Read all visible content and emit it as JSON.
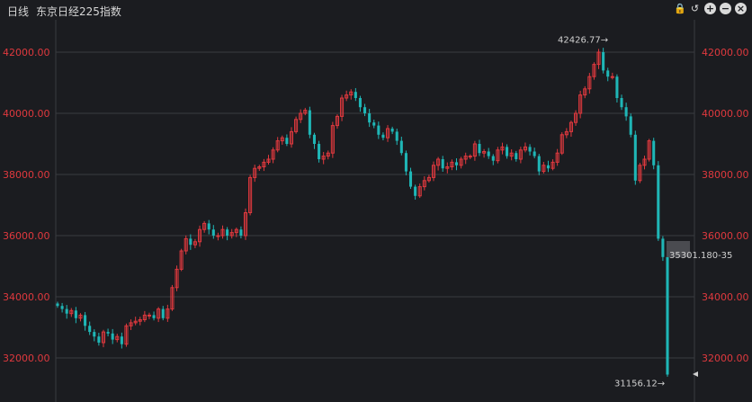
{
  "toolbar": {
    "period": "日线",
    "index_name": "东京日经225指数",
    "icons": [
      "lock-icon",
      "undo-icon",
      "zoom-in-icon",
      "zoom-out-icon",
      "close-icon"
    ]
  },
  "colors": {
    "background": "#1b1c20",
    "grid": "#3a3b40",
    "up": "#e0393e",
    "down": "#1fb6b6",
    "axis_text": "#e0393e"
  },
  "annotations": {
    "high_label": "42426.77→",
    "low_label": "31156.12→",
    "crosshair_label": "35301.180-35"
  },
  "chart_data": {
    "type": "candlestick",
    "ylim": [
      31000,
      43200
    ],
    "y_ticks": [
      32000,
      34000,
      36000,
      38000,
      40000,
      42000
    ],
    "y_tick_labels": [
      "32000.00",
      "34000.00",
      "36000.00",
      "38000.00",
      "40000.00",
      "42000.00"
    ],
    "grid": true,
    "max": 42426.77,
    "min": 31156.12,
    "closes": [
      33700,
      33600,
      33450,
      33550,
      33300,
      33400,
      33050,
      32850,
      32700,
      32500,
      32850,
      32800,
      32600,
      32700,
      32450,
      33050,
      33150,
      33200,
      33250,
      33400,
      33400,
      33300,
      33600,
      33300,
      33600,
      34300,
      34900,
      35500,
      35900,
      35700,
      35800,
      36200,
      36400,
      36200,
      36000,
      36000,
      36200,
      36000,
      36100,
      36200,
      36000,
      36750,
      37900,
      38200,
      38250,
      38400,
      38500,
      38800,
      39100,
      39200,
      39000,
      39400,
      39800,
      40000,
      40100,
      39300,
      39000,
      38500,
      38600,
      38700,
      39600,
      39900,
      40500,
      40600,
      40700,
      40500,
      40200,
      40000,
      39700,
      39600,
      39300,
      39200,
      39500,
      39400,
      39100,
      38700,
      38100,
      37600,
      37300,
      37600,
      37800,
      37900,
      38300,
      38500,
      38200,
      38250,
      38400,
      38300,
      38500,
      38600,
      38600,
      39000,
      38700,
      38750,
      38600,
      38450,
      38800,
      38900,
      38600,
      38700,
      38500,
      38800,
      38900,
      38750,
      38600,
      38100,
      38300,
      38200,
      38400,
      38700,
      39300,
      39400,
      39700,
      40000,
      40600,
      40800,
      41200,
      41600,
      42000,
      41400,
      41200,
      41200,
      40500,
      40200,
      39900,
      39300,
      37800,
      38300,
      38500,
      39100,
      38300,
      35900,
      35300,
      31456
    ]
  }
}
